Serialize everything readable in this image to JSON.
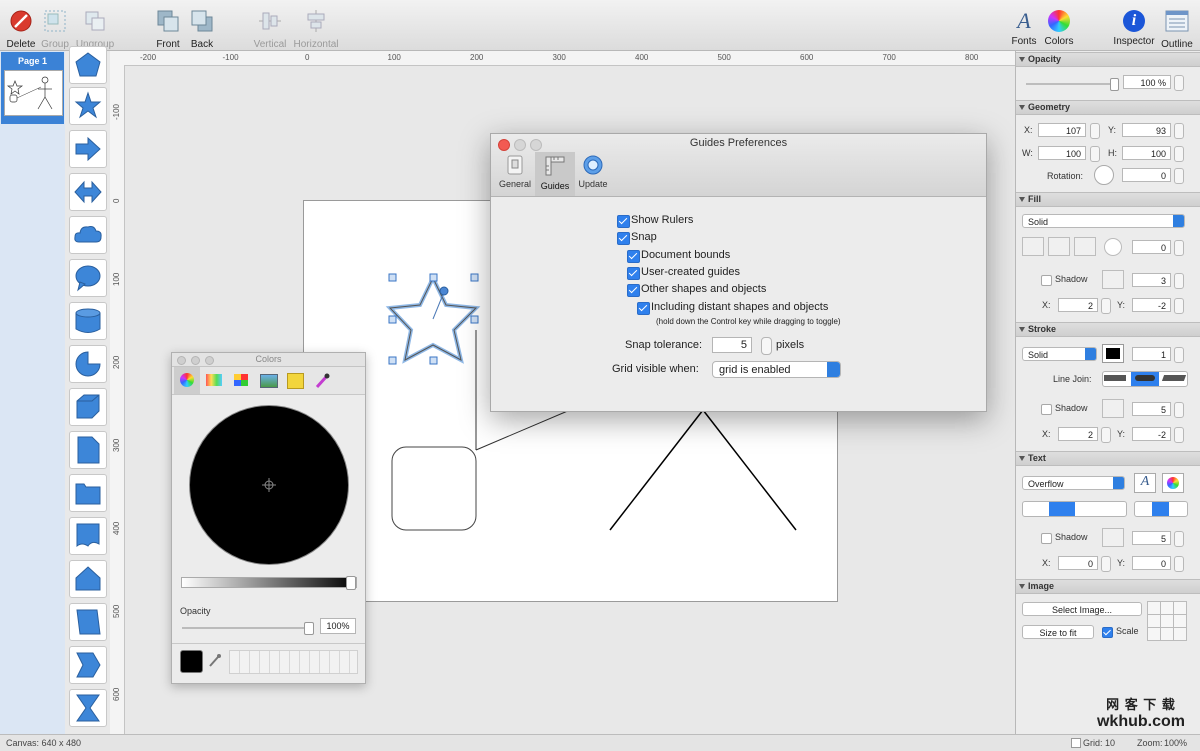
{
  "toolbar": {
    "delete": "Delete",
    "group": "Group",
    "ungroup": "Ungroup",
    "front": "Front",
    "back": "Back",
    "vertical": "Vertical",
    "horizontal": "Horizontal",
    "fonts": "Fonts",
    "colors": "Colors",
    "inspector": "Inspector",
    "outline": "Outline"
  },
  "pages": {
    "page1": "Page 1"
  },
  "shapes": [
    "pentagon",
    "star",
    "arrow-right",
    "double-arrow",
    "cloud",
    "speech-bubble",
    "cylinder",
    "pie",
    "cube",
    "folded-page",
    "folder",
    "banner",
    "house",
    "parallelogram",
    "chevron",
    "hourglass"
  ],
  "ruler": {
    "h": [
      "-200",
      "-100",
      "0",
      "100",
      "200",
      "300",
      "400",
      "500",
      "600",
      "700",
      "800"
    ],
    "v": [
      "-100",
      "0",
      "100",
      "200",
      "300",
      "400",
      "500",
      "600"
    ]
  },
  "status": {
    "canvas": "Canvas: 640 x 480",
    "grid_label": "Grid:",
    "grid_value": "10",
    "zoom_label": "Zoom:",
    "zoom_value": "100%"
  },
  "inspector": {
    "opacity": {
      "title": "Opacity",
      "value": "100 %",
      "level": 1.0
    },
    "geometry": {
      "title": "Geometry",
      "x_label": "X:",
      "x": "107",
      "y_label": "Y:",
      "y": "93",
      "w_label": "W:",
      "w": "100",
      "h_label": "H:",
      "h": "100",
      "rotation_label": "Rotation:",
      "rotation": "0"
    },
    "fill": {
      "title": "Fill",
      "type": "Solid",
      "angle": "0",
      "shadow": "Shadow",
      "shadow_blur": "3",
      "x_label": "X:",
      "x": "2",
      "y_label": "Y:",
      "y": "-2"
    },
    "stroke": {
      "title": "Stroke",
      "type": "Solid",
      "width": "1",
      "line_join": "Line Join:",
      "shadow": "Shadow",
      "shadow_blur": "5",
      "x_label": "X:",
      "x": "2",
      "y_label": "Y:",
      "y": "-2"
    },
    "text": {
      "title": "Text",
      "overflow": "Overflow",
      "shadow": "Shadow",
      "shadow_blur": "5",
      "x_label": "X:",
      "x": "0",
      "y_label": "Y:",
      "y": "0"
    },
    "image": {
      "title": "Image",
      "select": "Select Image...",
      "size_to_fit": "Size to fit",
      "scale": "Scale"
    }
  },
  "guides_dialog": {
    "title": "Guides Preferences",
    "tabs": [
      "General",
      "Guides",
      "Update"
    ],
    "show_rulers": "Show Rulers",
    "snap": "Snap",
    "document_bounds": "Document bounds",
    "user_guides": "User-created guides",
    "other_shapes": "Other shapes and objects",
    "distant_shapes": "Including distant shapes and objects",
    "hint": "(hold down the Control key while dragging to toggle)",
    "snap_tolerance_label": "Snap tolerance:",
    "snap_tolerance": "5",
    "pixels": "pixels",
    "grid_visible_label": "Grid visible when:",
    "grid_visible_value": "grid is enabled"
  },
  "colors_panel": {
    "title": "Colors",
    "opacity_label": "Opacity",
    "opacity_value": "100%",
    "selected_color": "#000000"
  },
  "watermark": {
    "line1": "网 客 下 载",
    "line2": "wkhub.com"
  },
  "colors": {
    "accent": "#2f80ed",
    "shape_fill": "#3d86d8",
    "page_selected": "#3b82d6"
  }
}
